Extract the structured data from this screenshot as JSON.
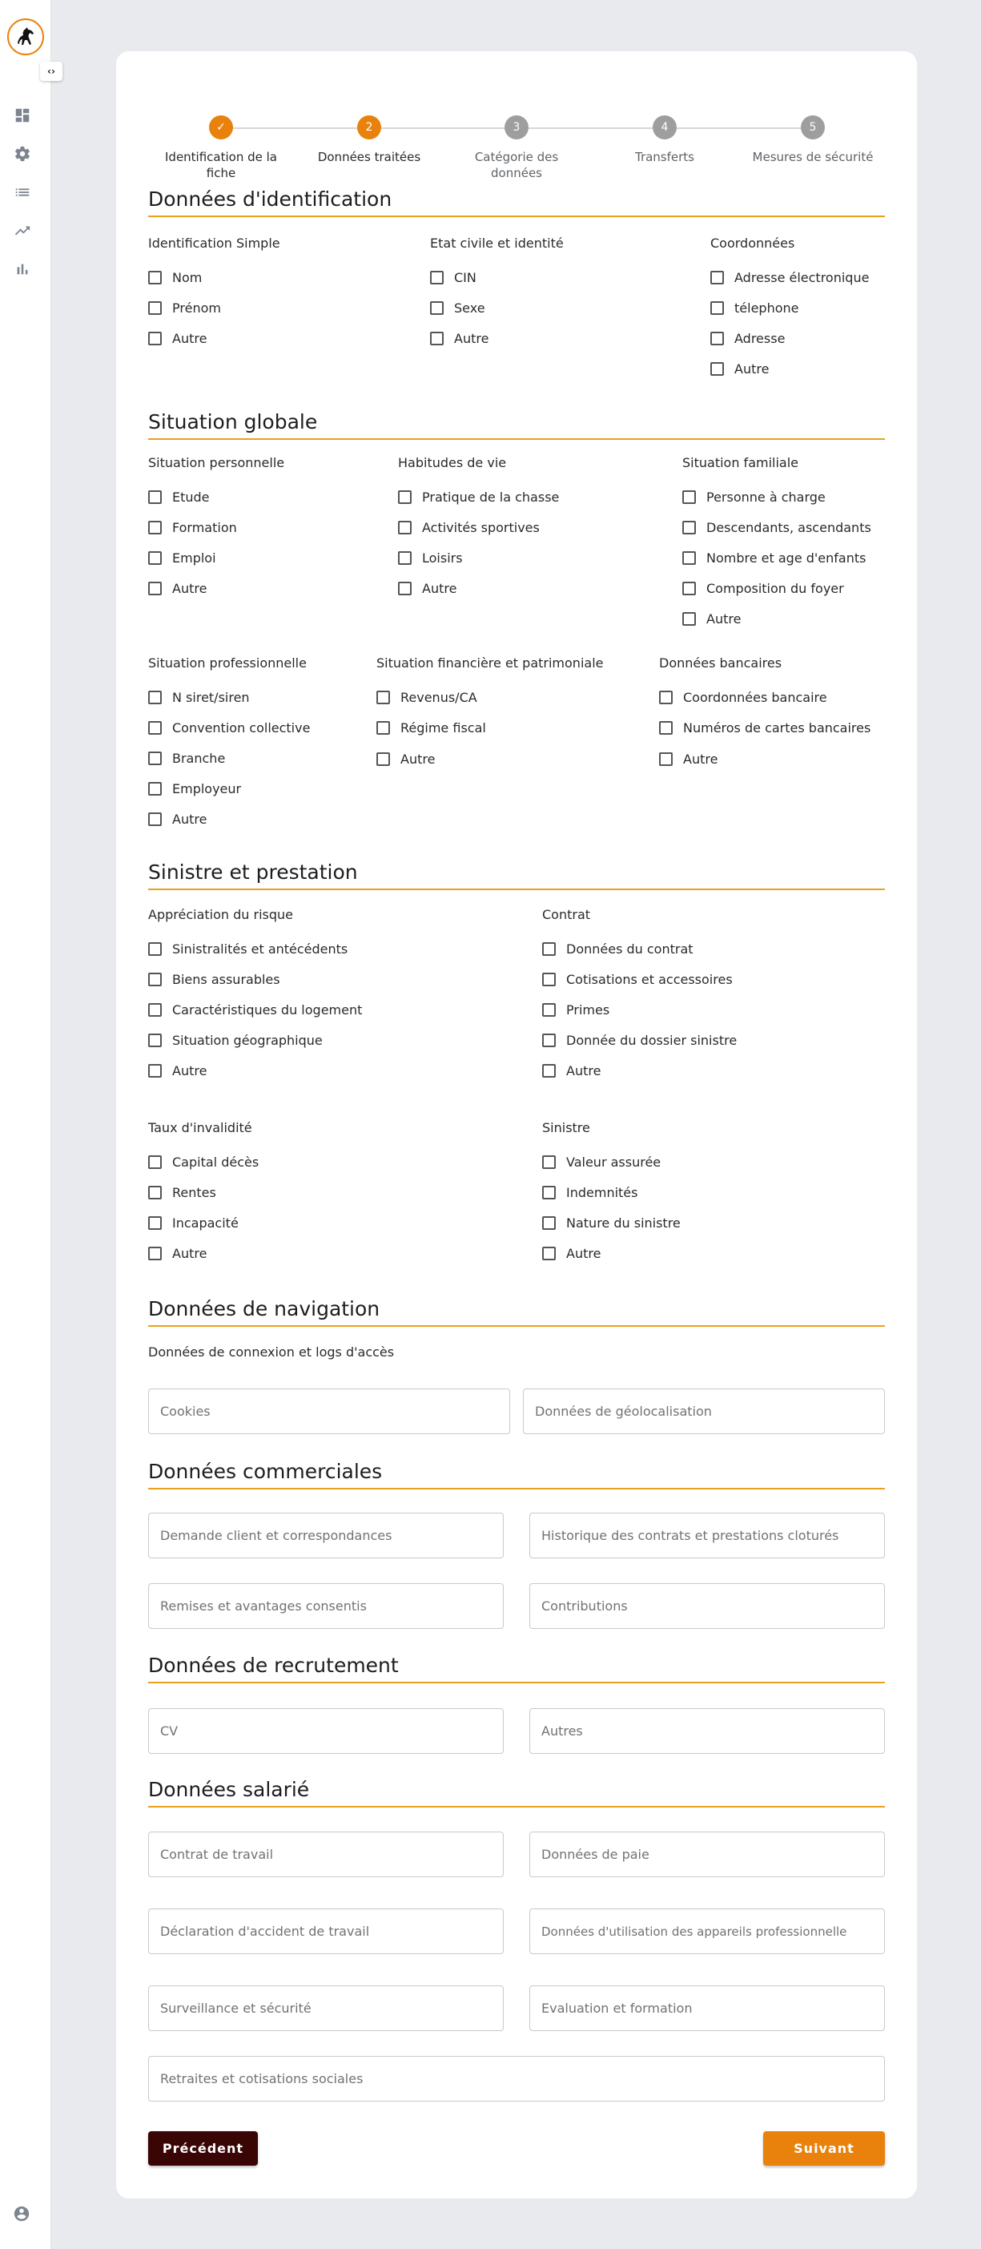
{
  "colors": {
    "accent": "#e8820c",
    "section_underline": "#eaa01f",
    "step_pending": "#9e9e9e",
    "prev_button": "#3a0505"
  },
  "sidebar": {
    "icons": [
      "dashboard-icon",
      "gear-icon",
      "list-icon",
      "trending-icon",
      "bar-chart-icon"
    ],
    "bottom_icon": "account-icon",
    "toggle_label": "‹›"
  },
  "stepper": {
    "steps": [
      {
        "num": "✓",
        "label": "Identification de la fiche",
        "state": "done"
      },
      {
        "num": "2",
        "label": "Données traitées",
        "state": "active"
      },
      {
        "num": "3",
        "label": "Catégorie des données",
        "state": "pending"
      },
      {
        "num": "4",
        "label": "Transferts",
        "state": "pending"
      },
      {
        "num": "5",
        "label": "Mesures de sécurité",
        "state": "pending"
      }
    ]
  },
  "identification": {
    "title": "Données d'identification",
    "groups": [
      {
        "title": "Identification Simple",
        "items": [
          "Nom",
          "Prénom",
          "Autre"
        ]
      },
      {
        "title": "Etat civile et identité",
        "items": [
          "CIN",
          "Sexe",
          "Autre"
        ]
      },
      {
        "title": "Coordonnées",
        "items": [
          "Adresse électronique",
          "télephone",
          "Adresse",
          "Autre"
        ]
      }
    ]
  },
  "situation": {
    "title": "Situation globale",
    "groups": [
      {
        "title": "Situation personnelle",
        "items": [
          "Etude",
          "Formation",
          "Emploi",
          "Autre"
        ]
      },
      {
        "title": "Habitudes de vie",
        "items": [
          "Pratique de la chasse",
          "Activités sportives",
          "Loisirs",
          "Autre"
        ]
      },
      {
        "title": "Situation familiale",
        "items": [
          "Personne à charge",
          "Descendants, ascendants",
          "Nombre et age d'enfants",
          "Composition du foyer",
          "Autre"
        ]
      },
      {
        "title": "Situation professionnelle",
        "items": [
          "N siret/siren",
          "Convention collective",
          "Branche",
          "Employeur",
          "Autre"
        ]
      },
      {
        "title": "Situation financière et patrimoniale",
        "items": [
          "Revenus/CA",
          "Régime fiscal",
          "Autre"
        ]
      },
      {
        "title": "Données bancaires",
        "items": [
          "Coordonnées bancaire",
          "Numéros de cartes bancaires",
          "Autre"
        ]
      }
    ]
  },
  "sinistre": {
    "title": "Sinistre et prestation",
    "groups": [
      {
        "title": "Appréciation du risque",
        "items": [
          "Sinistralités et antécédents",
          "Biens assurables",
          "Caractéristiques du logement",
          "Situation géographique",
          "Autre"
        ]
      },
      {
        "title": "Contrat",
        "items": [
          "Données du contrat",
          "Cotisations et accessoires",
          "Primes",
          "Donnée du dossier sinistre",
          "Autre"
        ]
      },
      {
        "title": "Taux d'invalidité",
        "items": [
          "Capital décès",
          "Rentes",
          "Incapacité",
          "Autre"
        ]
      },
      {
        "title": "Sinistre",
        "items": [
          "Valeur assurée",
          "Indemnités",
          "Nature du sinistre",
          "Autre"
        ]
      }
    ]
  },
  "navigation": {
    "title": "Données de navigation",
    "subtitle": "Données de connexion et logs d'accès",
    "fields": [
      "Cookies",
      "Données de géolocalisation"
    ]
  },
  "commerciales": {
    "title": "Données commerciales",
    "fields": [
      "Demande client et correspondances",
      "Historique des contrats et prestations cloturés",
      "Remises et avantages consentis",
      "Contributions"
    ]
  },
  "recrutement": {
    "title": "Données de recrutement",
    "fields": [
      "CV",
      "Autres"
    ]
  },
  "salarie": {
    "title": "Données salarié",
    "fields": [
      "Contrat de travail",
      "Données de paie",
      "Déclaration d'accident de travail",
      "Données d'utilisation des appareils professionnelle",
      "Surveillance et sécurité",
      "Evaluation et formation",
      "Retraites et cotisations sociales"
    ]
  },
  "actions": {
    "prev": "Précédent",
    "next": "Suivant"
  }
}
